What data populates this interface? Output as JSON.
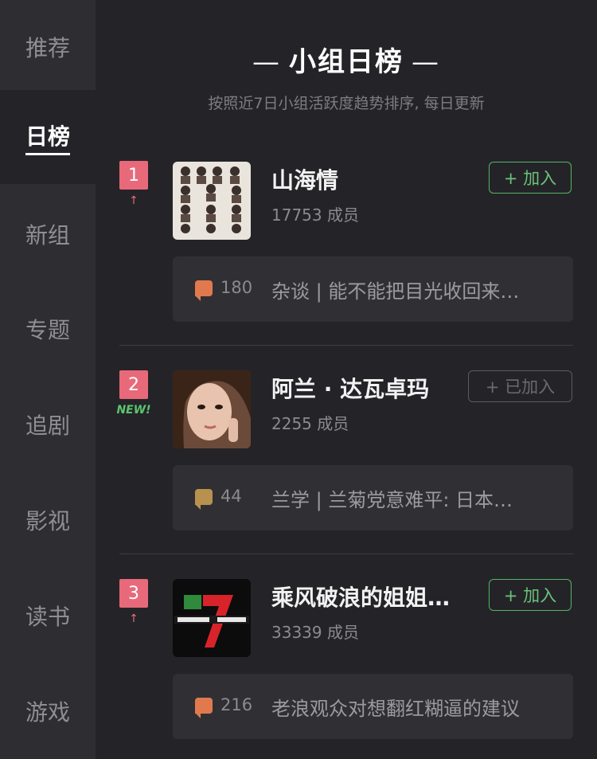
{
  "sidebar": {
    "items": [
      {
        "label": "推荐"
      },
      {
        "label": "日榜"
      },
      {
        "label": "新组"
      },
      {
        "label": "专题"
      },
      {
        "label": "追剧"
      },
      {
        "label": "影视"
      },
      {
        "label": "读书"
      },
      {
        "label": "游戏"
      }
    ]
  },
  "header": {
    "title": "小组日榜",
    "dash": "—",
    "subtitle": "按照近7日小组活跃度趋势排序, 每日更新"
  },
  "groups": [
    {
      "rank": "1",
      "trend": "↑",
      "name": "山海情",
      "members": "17753 成员",
      "join_label": "+ 加入",
      "post_count": "180",
      "post_text": "杂谈 | 能不能把目光收回来…",
      "bubble_color": "#e07a4e"
    },
    {
      "rank": "2",
      "trend": "NEW!",
      "name": "阿兰 · 达瓦卓玛",
      "members": "2255 成员",
      "join_label": "+ 已加入",
      "post_count": "44",
      "post_text": "兰学 | 兰菊党意难平: 日本…",
      "bubble_color": "#b8914e"
    },
    {
      "rank": "3",
      "trend": "↑",
      "name": "乘风破浪的姐姐…",
      "members": "33339 成员",
      "join_label": "+ 加入",
      "post_count": "216",
      "post_text": "老浪观众对想翻红糊逼的建议",
      "bubble_color": "#e07a4e"
    }
  ],
  "colors": {
    "accent_red": "#e8697a",
    "join_green": "#54b466",
    "new_green": "#5cc56e"
  }
}
